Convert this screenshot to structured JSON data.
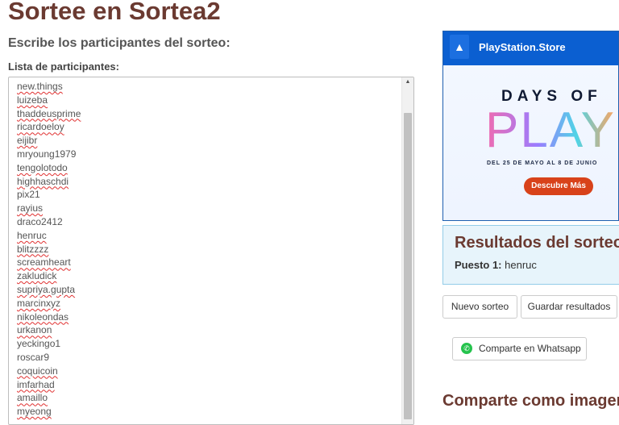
{
  "page": {
    "title": "Sortee en Sortea2",
    "subtitle": "Escribe los participantes del sorteo:",
    "list_label": "Lista de participantes:"
  },
  "participants": [
    {
      "name": "new.things",
      "flag": true
    },
    {
      "name": "luizeba",
      "flag": true
    },
    {
      "name": "thaddeusprime",
      "flag": true
    },
    {
      "name": "ricardoeloy",
      "flag": true
    },
    {
      "name": "eijibr",
      "flag": true
    },
    {
      "name": "mryoung1979",
      "flag": false
    },
    {
      "name": "tengolotodo",
      "flag": true
    },
    {
      "name": "highhaschdi",
      "flag": true
    },
    {
      "name": "pix21",
      "flag": false
    },
    {
      "name": "rayius",
      "flag": true
    },
    {
      "name": "draco2412",
      "flag": false
    },
    {
      "name": "henruc",
      "flag": true
    },
    {
      "name": "blitzzzz",
      "flag": true
    },
    {
      "name": "screamheart",
      "flag": true
    },
    {
      "name": "zakludick",
      "flag": true
    },
    {
      "name": "supriya.gupta",
      "flag": true
    },
    {
      "name": "marcinxyz",
      "flag": true
    },
    {
      "name": "nikoleondas",
      "flag": true
    },
    {
      "name": "urkanon",
      "flag": true
    },
    {
      "name": "yeckingo1",
      "flag": false
    },
    {
      "name": "roscar9",
      "flag": false
    },
    {
      "name": "coquicoin",
      "flag": true
    },
    {
      "name": "imfarhad",
      "flag": true
    },
    {
      "name": "amaillo",
      "flag": true
    },
    {
      "name": "myeong",
      "flag": true
    }
  ],
  "ad": {
    "store": "PlayStation.Store",
    "headline_1": "DAYS OF",
    "headline_2": "PLAY",
    "dates": "DEL 25 DE MAYO AL 8 DE JUNIO",
    "cta": "Descubre Más",
    "logo_icon": "playstation-icon"
  },
  "results": {
    "title": "Resultados del sorteo",
    "place_label": "Puesto 1:",
    "place_value": "henruc"
  },
  "actions": {
    "new_draw": "Nuevo sorteo",
    "save_results": "Guardar resultados",
    "share_whatsapp": "Comparte en Whatsapp",
    "whatsapp_icon": "whatsapp-icon"
  },
  "share_image_title": "Comparte como imagen",
  "colors": {
    "title": "#6b3a31",
    "results_bg": "#e7f4fb",
    "results_border": "#93cce8",
    "ad_header": "#0b5fd1",
    "cta": "#d8421a",
    "whatsapp": "#25c34d",
    "spell_underline": "#e03030"
  }
}
